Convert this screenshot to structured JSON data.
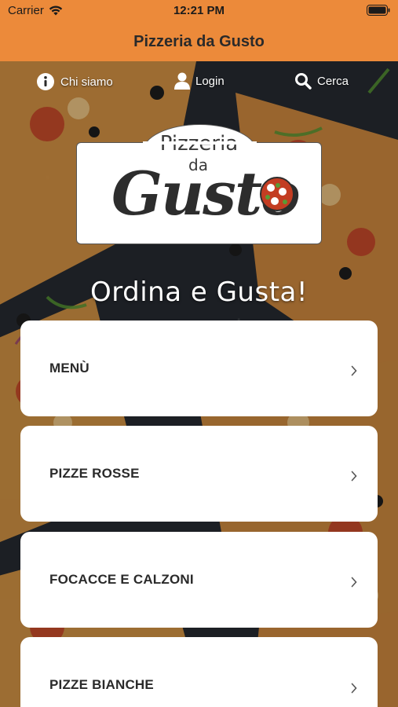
{
  "status_bar": {
    "carrier": "Carrier",
    "time": "12:21 PM"
  },
  "header": {
    "title": "Pizzeria da Gusto"
  },
  "top_nav": {
    "about": {
      "label": "Chi siamo",
      "icon": "info-icon"
    },
    "login": {
      "label": "Login",
      "icon": "user-icon"
    },
    "search": {
      "label": "Cerca",
      "icon": "search-icon"
    }
  },
  "logo": {
    "line1": "Pizzeria",
    "line2": "da",
    "line3": "Gusto"
  },
  "tagline": "Ordina e Gusta!",
  "categories": [
    {
      "label": "MENÙ"
    },
    {
      "label": "PIZZE ROSSE"
    },
    {
      "label": "FOCACCE E CALZONI"
    },
    {
      "label": "PIZZE BIANCHE"
    }
  ],
  "colors": {
    "accent": "#ec8a3a",
    "card": "#ffffff",
    "text": "#2a2a2a"
  }
}
